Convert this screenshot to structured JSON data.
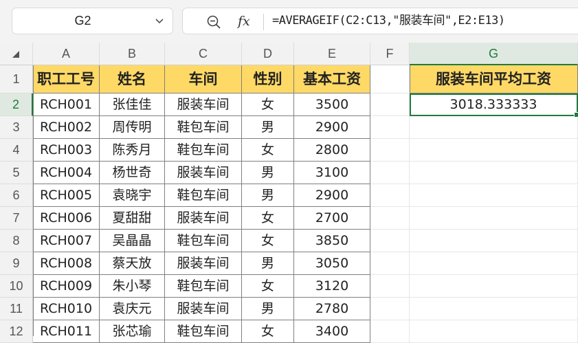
{
  "name_box": {
    "ref": "G2"
  },
  "formula_bar": {
    "fx": "fx",
    "formula": "=AVERAGEIF(C2:C13,\"服装车间\",E2:E13)"
  },
  "columns": [
    "A",
    "B",
    "C",
    "D",
    "E",
    "F",
    "G"
  ],
  "rows": [
    "1",
    "2",
    "3",
    "4",
    "5",
    "6",
    "7",
    "8",
    "9",
    "10",
    "11",
    "12"
  ],
  "headers": [
    "职工工号",
    "姓名",
    "车间",
    "性别",
    "基本工资"
  ],
  "table": [
    [
      "RCH001",
      "张佳佳",
      "服装车间",
      "女",
      "3500"
    ],
    [
      "RCH002",
      "周传明",
      "鞋包车间",
      "男",
      "2900"
    ],
    [
      "RCH003",
      "陈秀月",
      "鞋包车间",
      "女",
      "2800"
    ],
    [
      "RCH004",
      "杨世奇",
      "服装车间",
      "男",
      "3100"
    ],
    [
      "RCH005",
      "袁晓宇",
      "鞋包车间",
      "男",
      "2900"
    ],
    [
      "RCH006",
      "夏甜甜",
      "服装车间",
      "女",
      "2700"
    ],
    [
      "RCH007",
      "吴晶晶",
      "鞋包车间",
      "女",
      "3850"
    ],
    [
      "RCH008",
      "蔡天放",
      "服装车间",
      "男",
      "3050"
    ],
    [
      "RCH009",
      "朱小琴",
      "鞋包车间",
      "女",
      "3120"
    ],
    [
      "RCH010",
      "袁庆元",
      "服装车间",
      "男",
      "2780"
    ],
    [
      "RCH011",
      "张芯瑜",
      "鞋包车间",
      "女",
      "3400"
    ]
  ],
  "result": {
    "header": "服装车间平均工资",
    "value": "3018.333333"
  },
  "colors": {
    "header_fill": "#ffd966",
    "selection": "#1f7a3c"
  },
  "icons": {
    "name_box_dropdown": "chevron-down-icon",
    "zoom": "zoom-out-icon"
  }
}
